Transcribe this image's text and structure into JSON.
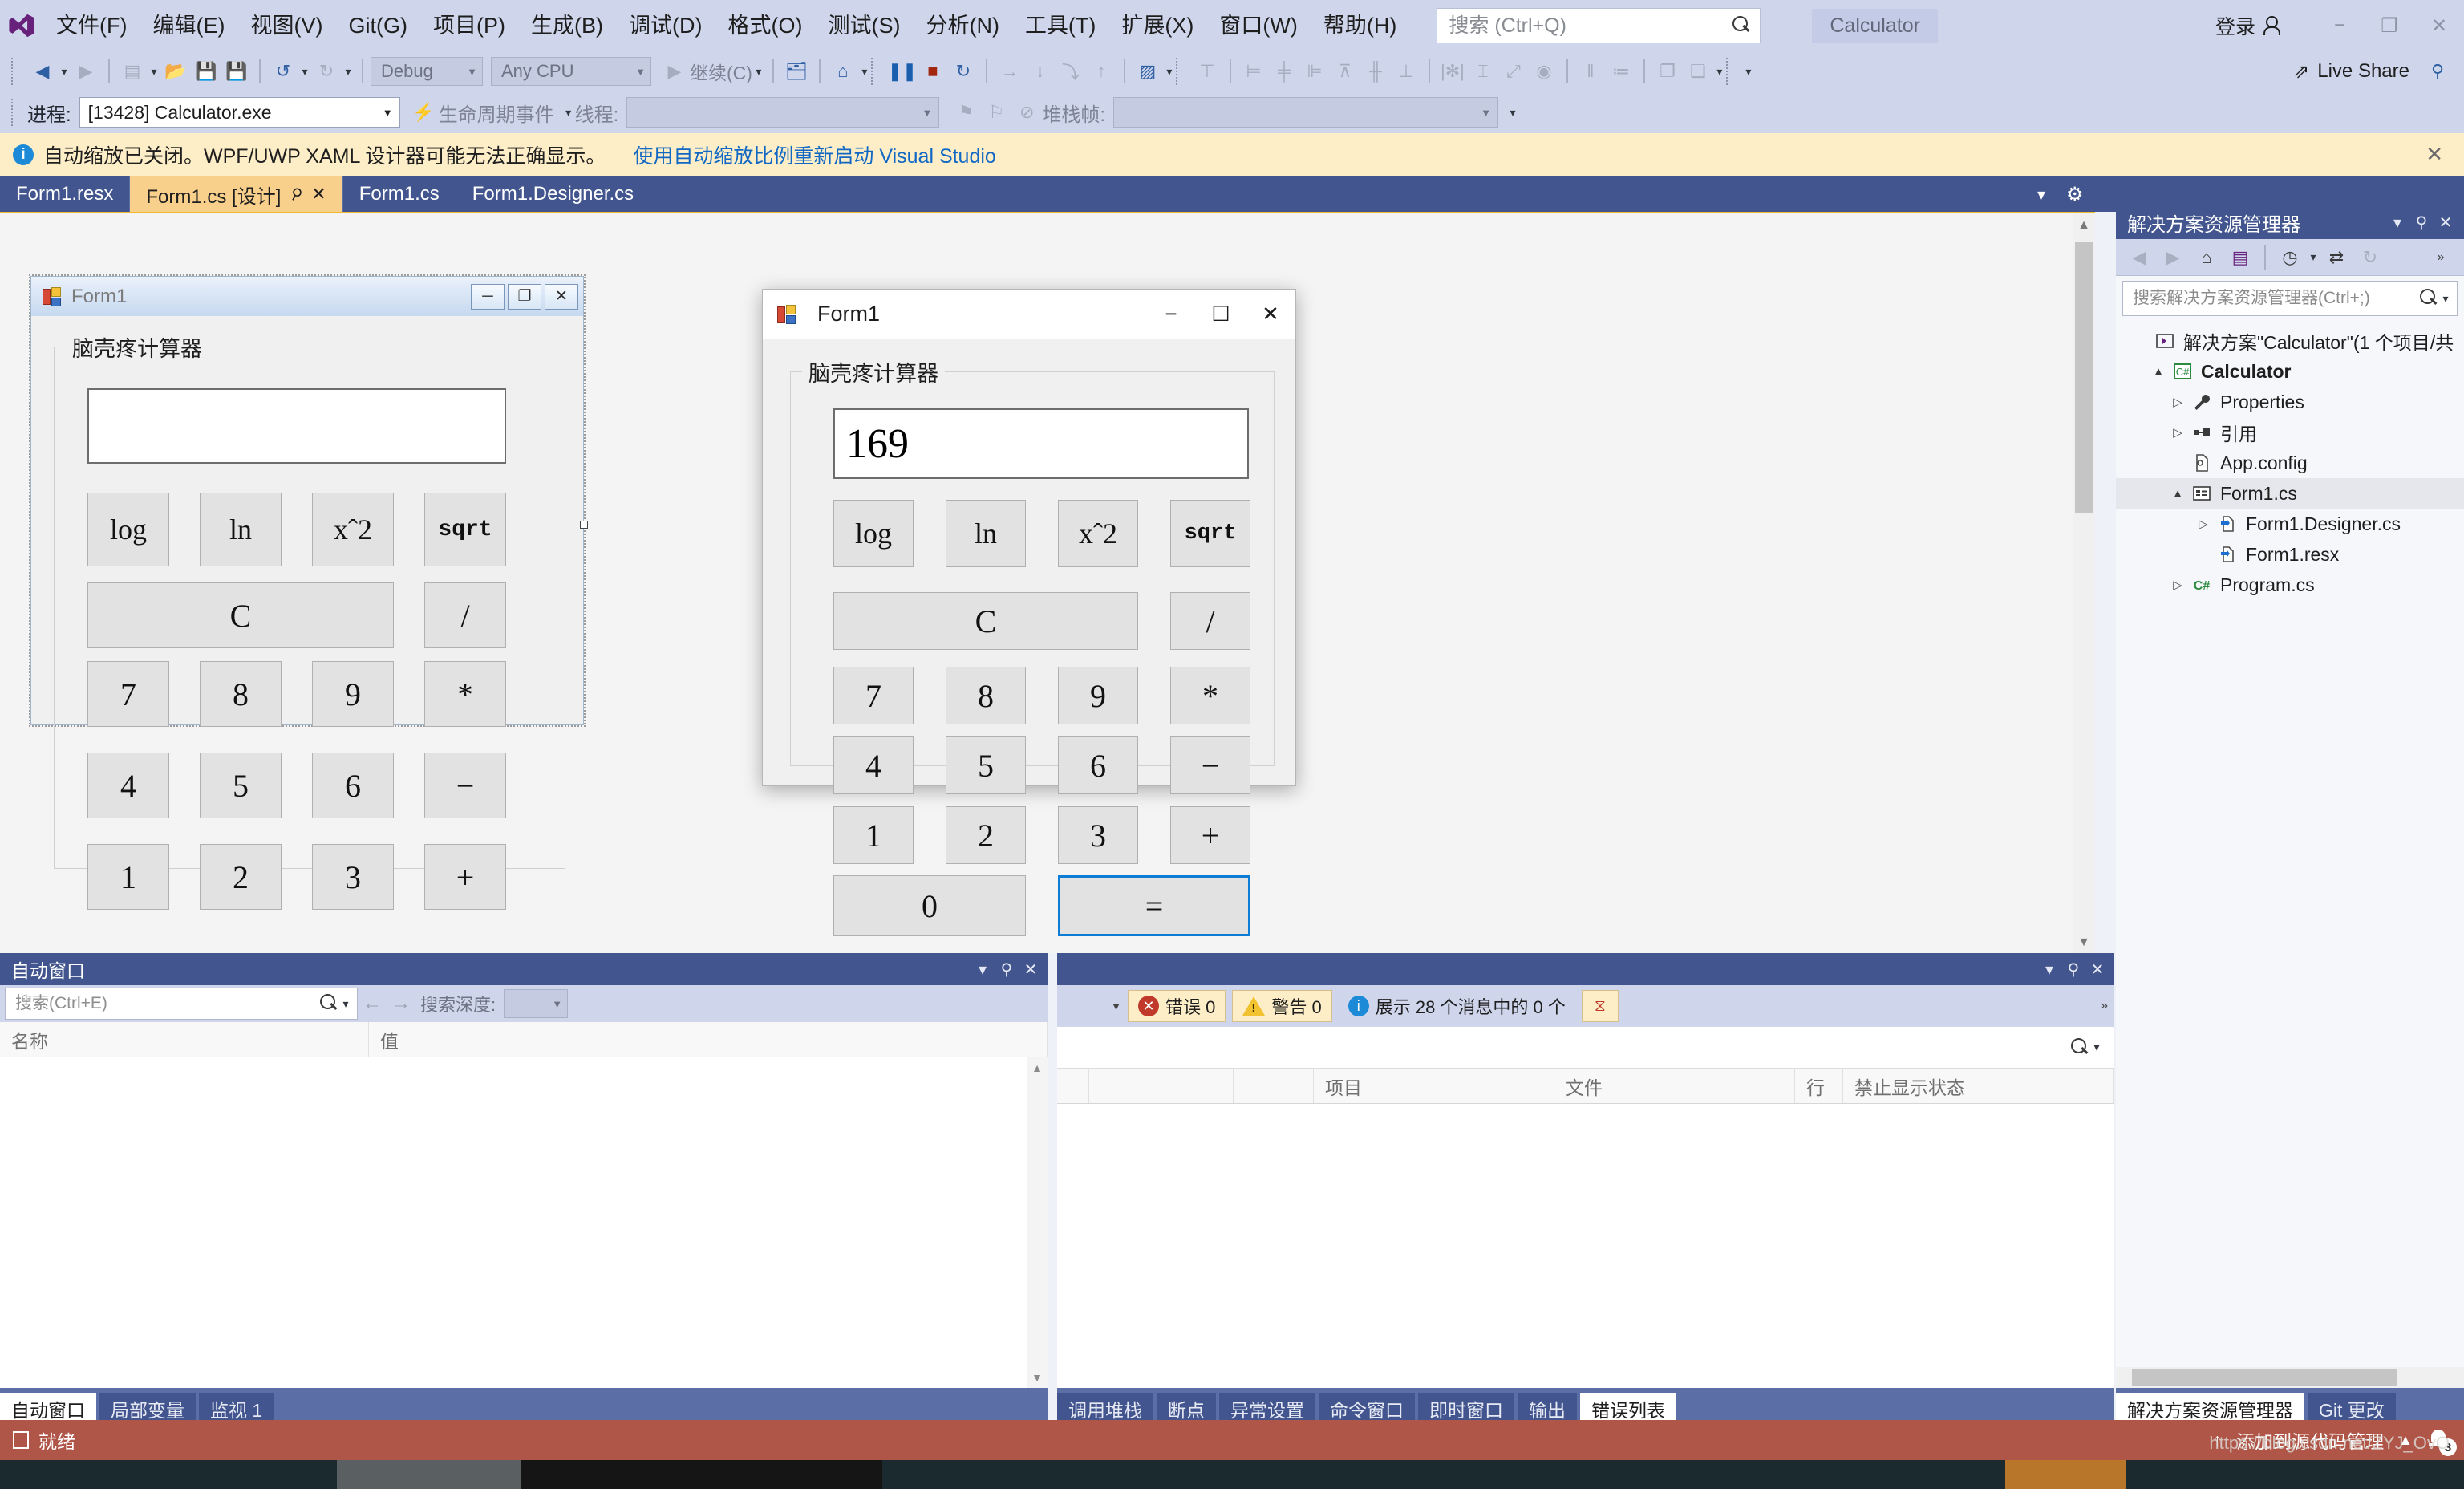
{
  "app": {
    "logo": "visual-studio-logo",
    "solution_chip": "Calculator",
    "signin_label": "登录"
  },
  "menu": {
    "items": [
      {
        "label": "文件(F)"
      },
      {
        "label": "编辑(E)"
      },
      {
        "label": "视图(V)"
      },
      {
        "label": "Git(G)"
      },
      {
        "label": "项目(P)"
      },
      {
        "label": "生成(B)"
      },
      {
        "label": "调试(D)"
      },
      {
        "label": "格式(O)"
      },
      {
        "label": "测试(S)"
      },
      {
        "label": "分析(N)"
      },
      {
        "label": "工具(T)"
      },
      {
        "label": "扩展(X)"
      },
      {
        "label": "窗口(W)"
      },
      {
        "label": "帮助(H)"
      }
    ]
  },
  "search": {
    "placeholder": "搜索 (Ctrl+Q)",
    "value": "",
    "icon": "search-icon"
  },
  "window_controls": {
    "minimize": "−",
    "maximize": "❐",
    "close": "✕"
  },
  "toolbar": {
    "config": "Debug",
    "platform": "Any CPU",
    "continue_label": "继续(C)",
    "live_share": "Live Share"
  },
  "debug_toolbar": {
    "process_label": "进程:",
    "process_value": "[13428] Calculator.exe",
    "lifecycle_label": "生命周期事件",
    "thread_label": "线程:",
    "thread_value": "",
    "stackframe_label": "堆栈帧:",
    "stackframe_value": ""
  },
  "infobar": {
    "icon": "info-icon",
    "message": "自动缩放已关闭。WPF/UWP XAML 设计器可能无法正确显示。",
    "link": "使用自动缩放比例重新启动 Visual Studio",
    "close": "✕"
  },
  "editor_tabs": [
    {
      "label": "Form1.resx",
      "active": false
    },
    {
      "label": "Form1.cs [设计]",
      "active": true
    },
    {
      "label": "Form1.cs",
      "active": false
    },
    {
      "label": "Form1.Designer.cs",
      "active": false
    }
  ],
  "designer_form": {
    "title": "Form1",
    "icon": "winforms-icon",
    "minimize": "─",
    "maximize": "❐",
    "close": "✕",
    "group_title": "脑壳疼计算器",
    "display_value": ""
  },
  "runtime_form": {
    "title": "Form1",
    "icon": "winforms-icon",
    "minimize": "−",
    "maximize": "☐",
    "close": "✕",
    "group_title": "脑壳疼计算器",
    "display_value": "169"
  },
  "calculator_keys": {
    "fn_row": [
      "log",
      "ln",
      "x^2",
      "sqrt"
    ],
    "fn_row_display": [
      "log",
      "ln",
      "xˆ2",
      "sqrt"
    ],
    "clear": "C",
    "divide": "/",
    "row1": [
      "7",
      "8",
      "9",
      "*"
    ],
    "row2": [
      "4",
      "5",
      "6",
      "−"
    ],
    "row3": [
      "1",
      "2",
      "3",
      "+"
    ],
    "zero": "0",
    "equals": "=",
    "focused_key": "="
  },
  "solution_explorer": {
    "title": "解决方案资源管理器",
    "search_placeholder": "搜索解决方案资源管理器(Ctrl+;)",
    "search_value": "",
    "toolbar_icons": [
      "back-icon",
      "forward-icon",
      "home-icon",
      "sync-with-active-document-icon",
      "pending-changes-filter-icon",
      "show-all-files-icon",
      "refresh-icon"
    ],
    "tree": [
      {
        "label": "解决方案\"Calculator\"(1 个项目/共",
        "indent": 0,
        "twisty": "",
        "icon": "solution-icon",
        "bold": false,
        "selected": false
      },
      {
        "label": "Calculator",
        "indent": 1,
        "twisty": "▲",
        "icon": "csharp-project-icon",
        "bold": true,
        "selected": false
      },
      {
        "label": "Properties",
        "indent": 2,
        "twisty": "▷",
        "icon": "wrench-icon",
        "bold": false,
        "selected": false
      },
      {
        "label": "引用",
        "indent": 2,
        "twisty": "▷",
        "icon": "references-icon",
        "bold": false,
        "selected": false
      },
      {
        "label": "App.config",
        "indent": 2,
        "twisty": "",
        "icon": "config-file-icon",
        "bold": false,
        "selected": false
      },
      {
        "label": "Form1.cs",
        "indent": 2,
        "twisty": "▲",
        "icon": "form-icon",
        "bold": false,
        "selected": true
      },
      {
        "label": "Form1.Designer.cs",
        "indent": 3,
        "twisty": "▷",
        "icon": "csharp-file-icon",
        "bold": false,
        "selected": false
      },
      {
        "label": "Form1.resx",
        "indent": 3,
        "twisty": "",
        "icon": "resx-file-icon",
        "bold": false,
        "selected": false
      },
      {
        "label": "Program.cs",
        "indent": 2,
        "twisty": "▷",
        "icon": "csharp-icon",
        "bold": false,
        "selected": false
      }
    ]
  },
  "autos_panel": {
    "title": "自动窗口",
    "search_placeholder": "搜索(Ctrl+E)",
    "search_value": "",
    "depth_label": "搜索深度:",
    "depth_value": "",
    "columns": [
      "名称",
      "值"
    ]
  },
  "error_list": {
    "errors_label": "错误 0",
    "warnings_label": "警告 0",
    "messages_label": "展示 28 个消息中的 0 个",
    "filter_icon": "clear-filter-icon",
    "search_icon": "search-icon",
    "columns": [
      "",
      "",
      "",
      "",
      "项目",
      "文件",
      "行",
      "禁止显示状态"
    ]
  },
  "bottom_tabs_left": [
    {
      "label": "自动窗口",
      "active": true
    },
    {
      "label": "局部变量",
      "active": false
    },
    {
      "label": "监视 1",
      "active": false
    }
  ],
  "bottom_tabs_mid": [
    {
      "label": "调用堆栈",
      "active": false
    },
    {
      "label": "断点",
      "active": false
    },
    {
      "label": "异常设置",
      "active": false
    },
    {
      "label": "命令窗口",
      "active": false
    },
    {
      "label": "即时窗口",
      "active": false
    },
    {
      "label": "输出",
      "active": false
    },
    {
      "label": "错误列表",
      "active": true
    }
  ],
  "bottom_tabs_right": [
    {
      "label": "解决方案资源管理器",
      "active": true
    },
    {
      "label": "Git 更改",
      "active": false
    }
  ],
  "statusbar": {
    "ready": "就绪",
    "source_control": "添加到源代码管理",
    "notification_count": "3"
  },
  "watermark": "https://blog.csdn.net/ZYJ_OvO",
  "colors": {
    "menubar": "#cfd6ec",
    "accent_tab": "#f8d08c",
    "panel_header": "#42558e",
    "status_debug": "#b05648",
    "infobar": "#fdeec8",
    "focus_blue": "#0c7cd5"
  }
}
